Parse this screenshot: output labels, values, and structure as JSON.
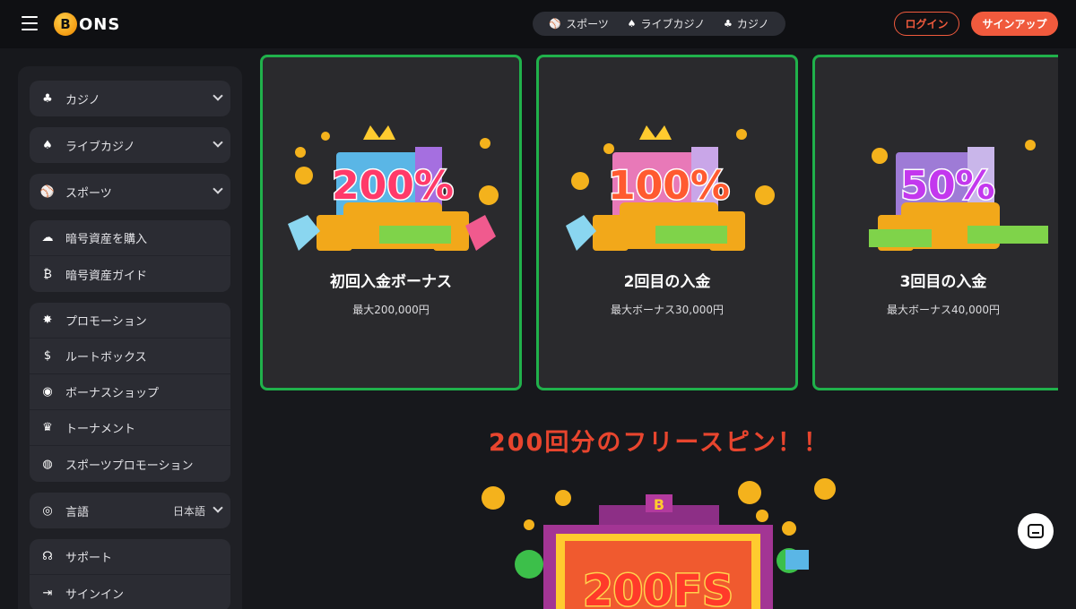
{
  "header": {
    "logo_letter": "B",
    "logo_text": "ONS",
    "nav": [
      {
        "label": "スポーツ",
        "icon": "sports-icon"
      },
      {
        "label": "ライブカジノ",
        "icon": "live-casino-icon"
      },
      {
        "label": "カジノ",
        "icon": "casino-icon"
      }
    ],
    "login_label": "ログイン",
    "signup_label": "サインアップ"
  },
  "sidebar": {
    "games": [
      {
        "label": "カジノ",
        "icon": "casino-icon"
      },
      {
        "label": "ライブカジノ",
        "icon": "live-casino-icon"
      },
      {
        "label": "スポーツ",
        "icon": "sports-icon"
      }
    ],
    "crypto": [
      {
        "label": "暗号資産を購入",
        "icon": "crypto-buy-icon"
      },
      {
        "label": "暗号資産ガイド",
        "icon": "bitcoin-icon"
      }
    ],
    "promos": [
      {
        "label": "プロモーション",
        "icon": "promotion-icon"
      },
      {
        "label": "ルートボックス",
        "icon": "lootbox-icon"
      },
      {
        "label": "ボーナスショップ",
        "icon": "bonus-shop-icon"
      },
      {
        "label": "トーナメント",
        "icon": "trophy-icon"
      },
      {
        "label": "スポーツプロモーション",
        "icon": "sports-promo-icon"
      }
    ],
    "language": {
      "label": "言語",
      "value": "日本語",
      "icon": "globe-icon"
    },
    "support": [
      {
        "label": "サポート",
        "icon": "headset-icon"
      },
      {
        "label": "サインイン",
        "icon": "signin-icon"
      }
    ]
  },
  "cards": [
    {
      "badge": "200%",
      "title": "初回入金ボーナス",
      "sub": "最大200,000円",
      "color": "#e8345f"
    },
    {
      "badge": "100%",
      "title": "2回目の入金",
      "sub": "最大ボーナス30,000円",
      "color": "#f0502f"
    },
    {
      "badge": "50%",
      "title": "3回目の入金",
      "sub": "最大ボーナス40,000円",
      "color": "#b53de0"
    }
  ],
  "promo_title": "200回分のフリースピン！！",
  "slot_badge": "200FS",
  "colors": {
    "accent": "#f05a3d",
    "card_border": "#20b14b",
    "promo_red": "#e8452e"
  }
}
